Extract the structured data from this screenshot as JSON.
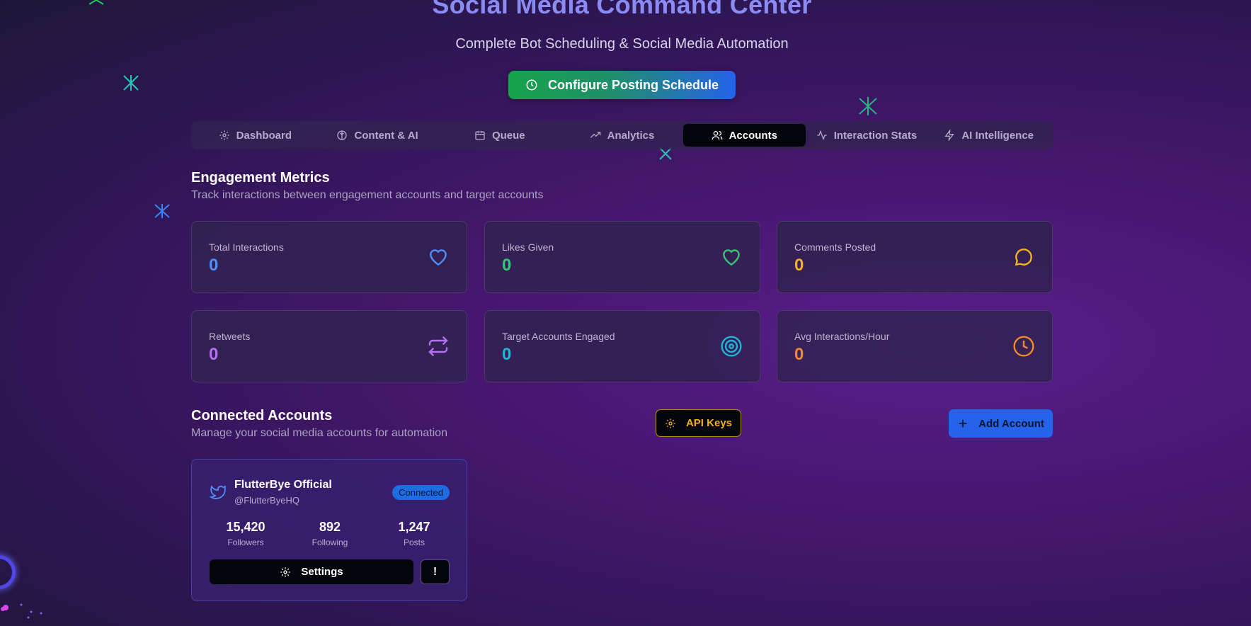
{
  "header": {
    "title": "Social Media Command Center",
    "subtitle": "Complete Bot Scheduling & Social Media Automation",
    "configure_button": "Configure Posting Schedule"
  },
  "tabs": [
    {
      "label": "Dashboard",
      "icon": "gear-icon"
    },
    {
      "label": "Content & AI",
      "icon": "brain-icon"
    },
    {
      "label": "Queue",
      "icon": "calendar-icon"
    },
    {
      "label": "Analytics",
      "icon": "trending-up-icon"
    },
    {
      "label": "Accounts",
      "icon": "users-icon",
      "active": true
    },
    {
      "label": "Interaction Stats",
      "icon": "activity-icon"
    },
    {
      "label": "AI Intelligence",
      "icon": "lightning-icon"
    }
  ],
  "engagement": {
    "title": "Engagement Metrics",
    "subtitle": "Track interactions between engagement accounts and target accounts",
    "metrics": [
      {
        "label": "Total Interactions",
        "value": "0",
        "icon": "heart-icon",
        "color": "#4f8ff7"
      },
      {
        "label": "Likes Given",
        "value": "0",
        "icon": "heart-icon",
        "color": "#34c773"
      },
      {
        "label": "Comments Posted",
        "value": "0",
        "icon": "message-circle-icon",
        "color": "#f0b31d"
      },
      {
        "label": "Retweets",
        "value": "0",
        "icon": "repeat-icon",
        "color": "#b472f0"
      },
      {
        "label": "Target Accounts Engaged",
        "value": "0",
        "icon": "target-icon",
        "color": "#20b4d8"
      },
      {
        "label": "Avg Interactions/Hour",
        "value": "0",
        "icon": "clock-icon",
        "color": "#f08a2a"
      }
    ]
  },
  "accounts": {
    "title": "Connected Accounts",
    "subtitle": "Manage your social media accounts for automation",
    "api_keys_button": "API Keys",
    "add_account_button": "Add Account",
    "list": [
      {
        "name": "FlutterBye Official",
        "handle": "@FlutterByeHQ",
        "status": "Connected",
        "platform_icon": "twitter-icon",
        "followers": "15,420",
        "followers_label": "Followers",
        "following": "892",
        "following_label": "Following",
        "posts": "1,247",
        "posts_label": "Posts",
        "settings_button": "Settings",
        "warn_button": "!"
      }
    ]
  }
}
